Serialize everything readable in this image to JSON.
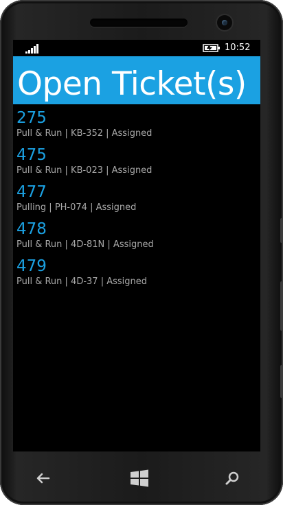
{
  "status_bar": {
    "time": "10:52",
    "signal_icon": "signal-strength-icon",
    "battery_icon": "battery-charging-icon"
  },
  "header": {
    "title": "Open Ticket(s)"
  },
  "tickets": [
    {
      "number": "275",
      "detail": "Pull & Run | KB-352 | Assigned"
    },
    {
      "number": "475",
      "detail": "Pull & Run | KB-023 | Assigned"
    },
    {
      "number": "477",
      "detail": "Pulling | PH-074 | Assigned"
    },
    {
      "number": "478",
      "detail": "Pull & Run | 4D-81N | Assigned"
    },
    {
      "number": "479",
      "detail": "Pull & Run | 4D-37 | Assigned"
    }
  ],
  "nav": {
    "back_icon": "back-arrow-icon",
    "start_icon": "windows-start-icon",
    "search_icon": "search-icon"
  },
  "colors": {
    "accent": "#1ba1e2",
    "background": "#000000",
    "subtext": "#a8a8a8"
  }
}
